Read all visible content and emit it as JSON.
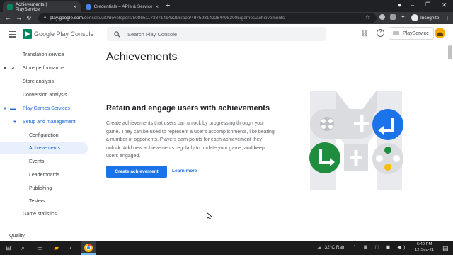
{
  "browser": {
    "tabs": [
      {
        "title": "Achievements | PlayService",
        "active": true
      },
      {
        "title": "Credentials – APIs & Services – P...",
        "active": false
      }
    ],
    "url_host": "play.google.com",
    "url_path": "/console/u/0/developers/5086511738714143296/app/4975981422844982005/games/achievements",
    "profile_label": "Incognito"
  },
  "header": {
    "brand": "Google Play Console",
    "search_placeholder": "Search Play Console",
    "developer_name": "PlayService"
  },
  "sidebar": {
    "items": [
      {
        "label": "Translation service"
      },
      {
        "label": "Store performance"
      },
      {
        "label": "Store analysis"
      },
      {
        "label": "Conversion analysis"
      },
      {
        "label": "Play Games Services"
      },
      {
        "label": "Setup and management"
      },
      {
        "label": "Configuration"
      },
      {
        "label": "Achievements"
      },
      {
        "label": "Events"
      },
      {
        "label": "Leaderboards"
      },
      {
        "label": "Publishing"
      },
      {
        "label": "Testers"
      },
      {
        "label": "Game statistics"
      },
      {
        "label": "Quality"
      }
    ]
  },
  "main": {
    "title": "Achievements",
    "headline": "Retain and engage users with achievements",
    "description": "Create achievements that users can unlock by progressing through your game. They can be used to represent a user's accomplishments, like beating a number of opponents. Players earn points for each achievement they unlock. Add new achievements regularly to update your game, and keep users engaged.",
    "create_button": "Create achievement",
    "learn_more": "Learn more"
  },
  "taskbar": {
    "weather": "32°C  Rain",
    "time": "6:40 PM",
    "date": "12-Sep-21"
  },
  "colors": {
    "accent": "#1a73e8",
    "selected_bg": "#e8f0fe",
    "illus_blue": "#1a73e8",
    "illus_green": "#1e8e3e",
    "illus_yellow": "#fbbc04",
    "illus_gray": "#dadce0"
  }
}
